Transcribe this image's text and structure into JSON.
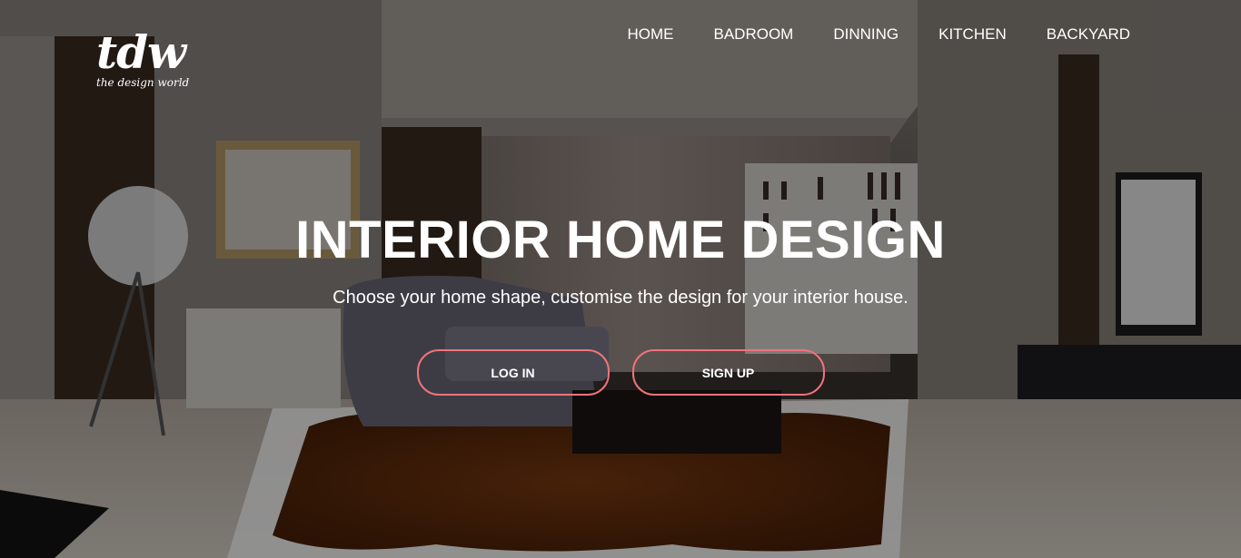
{
  "brand": {
    "logo_mark": "tdw",
    "tagline": "the design world"
  },
  "nav": {
    "items": [
      {
        "label": "HOME"
      },
      {
        "label": "BADROOM"
      },
      {
        "label": "DINNING"
      },
      {
        "label": "KITCHEN"
      },
      {
        "label": "BACKYARD"
      }
    ]
  },
  "hero": {
    "title": "INTERIOR HOME DESIGN",
    "subtitle": "Choose your home shape, customise the design for your interior house.",
    "login_label": "LOG IN",
    "signup_label": "SIGN UP",
    "button_border_color": "#f0737b",
    "background_image": "living-room-interior-photo"
  }
}
